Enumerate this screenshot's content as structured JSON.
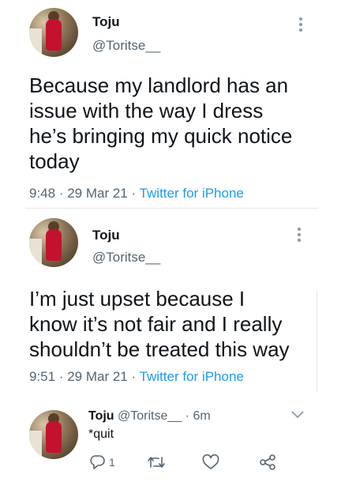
{
  "tweet1": {
    "name": "Toju",
    "handle": "@Toritse__",
    "text_lines": [
      "Because my landlord has an",
      "issue with the way I dress",
      "he’s bringing my quick notice",
      "today"
    ],
    "time": "9:48",
    "date": "29 Mar 21",
    "source": "Twitter for iPhone"
  },
  "tweet2": {
    "name": "Toju",
    "handle": "@Toritse__",
    "text_lines": [
      "I’m just upset because I",
      "know it’s not fair and I really",
      "shouldn’t be treated this way"
    ],
    "time": "9:51",
    "date": "29 Mar 21",
    "source": "Twitter for iPhone"
  },
  "reply": {
    "name": "Toju",
    "handle": "@Toritse__",
    "age": "6m",
    "text": "*quit",
    "reply_count": "1",
    "icons": [
      "reply-icon",
      "retweet-icon",
      "like-icon",
      "share-icon"
    ]
  },
  "colors": {
    "text": "#0f1419",
    "secondary": "#536471",
    "link": "#1d9bf0",
    "divider": "#e1e8ed"
  }
}
